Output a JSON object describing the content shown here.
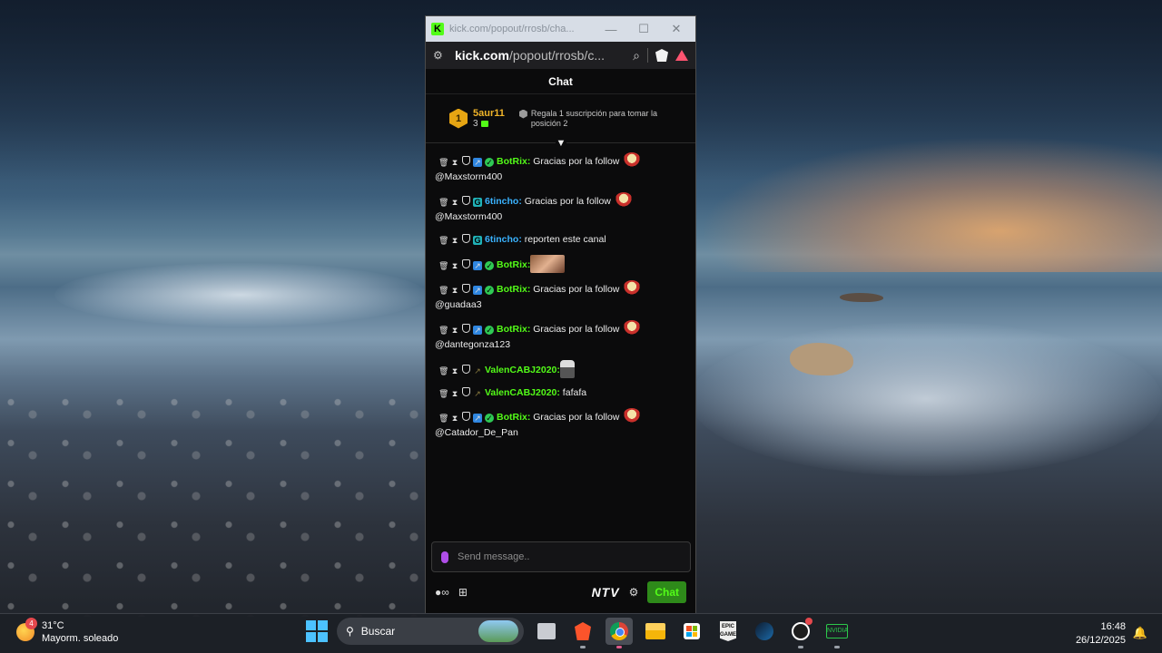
{
  "window": {
    "title": "kick.com/popout/rrosb/cha...",
    "url_host": "kick.com",
    "url_path": "/popout/rrosb/c..."
  },
  "chat": {
    "header": "Chat",
    "pinned": {
      "rank": "1",
      "gifter_name": "5aur11",
      "gifter_count": "3",
      "promo_text": "Regala 1 suscripción para tomar la posición 2"
    },
    "messages": [
      {
        "user": "BotRix:",
        "text": " Gracias por la follow",
        "mention": "@Maxstorm400",
        "color": "#53fc18",
        "badges": [
          "bot",
          "verified"
        ],
        "emote": "emote"
      },
      {
        "user": "6tincho:",
        "text": " Gracias por la follow",
        "mention": "@Maxstorm400",
        "color": "#3ab3ff",
        "badges": [
          "og"
        ],
        "emote": "emote"
      },
      {
        "user": "6tincho:",
        "text": " reporten este canal",
        "mention": "",
        "color": "#3ab3ff",
        "badges": [
          "og"
        ],
        "emote": ""
      },
      {
        "user": "BotRix:",
        "text": "",
        "mention": "",
        "color": "#53fc18",
        "badges": [
          "bot",
          "verified"
        ],
        "emote": "emote2"
      },
      {
        "user": "BotRix:",
        "text": " Gracias por la follow",
        "mention": "@guadaa3",
        "color": "#53fc18",
        "badges": [
          "bot",
          "verified"
        ],
        "emote": "emote"
      },
      {
        "user": "BotRix:",
        "text": " Gracias por la follow",
        "mention": "@dantegonza123",
        "color": "#53fc18",
        "badges": [
          "bot",
          "verified"
        ],
        "emote": "emote"
      },
      {
        "user": "ValenCABJ2020:",
        "text": "",
        "mention": "",
        "color": "#53fc18",
        "badges": [
          "arrow"
        ],
        "emote": "emote3"
      },
      {
        "user": "ValenCABJ2020:",
        "text": " fafafa",
        "mention": "",
        "color": "#53fc18",
        "badges": [
          "arrow"
        ],
        "emote": ""
      },
      {
        "user": "BotRix:",
        "text": " Gracias por la follow",
        "mention": "@Catador_De_Pan",
        "color": "#53fc18",
        "badges": [
          "bot",
          "verified"
        ],
        "emote": "emote"
      }
    ],
    "input_placeholder": "Send message..",
    "ntv_label": "NTV",
    "chat_button": "Chat"
  },
  "taskbar": {
    "weather_badge": "4",
    "weather_temp": "31°C",
    "weather_desc": "Mayorm. soleado",
    "search_label": "Buscar",
    "time": "16:48",
    "date": "26/12/2025",
    "epic_label": "EPIC GAMES",
    "green_app_label": "NVIDIA"
  },
  "colors": {
    "kick_green": "#53fc18",
    "accent_blue": "#3ab3ff",
    "gifter_gold": "#f0b429"
  }
}
